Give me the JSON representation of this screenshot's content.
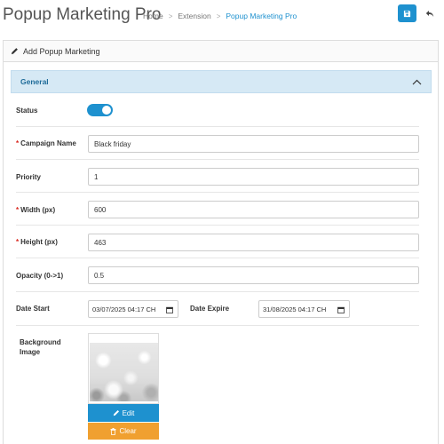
{
  "header": {
    "title": "Popup Marketing Pro",
    "breadcrumb": [
      "Home",
      "Extension",
      "Popup Marketing Pro"
    ],
    "save_icon": "save-icon",
    "back_icon": "reply-icon",
    "accent": "#1e91cf"
  },
  "panel": {
    "heading": "Add Popup Marketing",
    "heading_icon": "pencil-icon",
    "section": {
      "label": "General",
      "toggle_icon": "chevron-up-icon"
    }
  },
  "form": {
    "status": {
      "label": "Status",
      "enabled": true
    },
    "campaign_name": {
      "label": "Campaign Name",
      "value": "Black friday",
      "required": true
    },
    "priority": {
      "label": "Priority",
      "value": "1"
    },
    "width": {
      "label": "Width (px)",
      "value": "600",
      "required": true
    },
    "height": {
      "label": "Height (px)",
      "value": "463",
      "required": true
    },
    "opacity": {
      "label": "Opacity (0->1)",
      "value": "0.5"
    },
    "date_start": {
      "label": "Date Start",
      "value": "03/07/2025 04:17 CH"
    },
    "date_expire": {
      "label": "Date Expire",
      "value": "31/08/2025 04:17 CH"
    },
    "background_image": {
      "label_line1": "Background",
      "label_line2": "Image"
    },
    "edit_label": "Edit",
    "clear_label": "Clear"
  }
}
